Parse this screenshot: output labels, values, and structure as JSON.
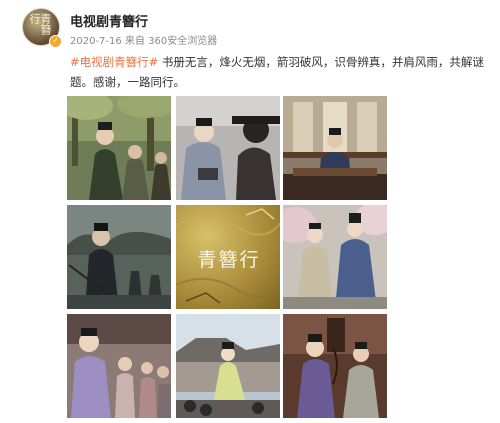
{
  "account": {
    "name": "电视剧青簪行",
    "avatar_text": "青簪行",
    "verified_icon": "verified-badge-icon"
  },
  "post": {
    "meta": "2020-7-16  来自 360安全浏览器",
    "hashtag": "#电视剧青簪行#",
    "text": " 书册无言，烽火无烟，箭羽破风，识骨辨真，并肩风雨，共解谜题。感谢，一路同行。"
  },
  "images": [
    {
      "name": "photo-1"
    },
    {
      "name": "photo-2"
    },
    {
      "name": "photo-3"
    },
    {
      "name": "photo-4"
    },
    {
      "name": "title-logo",
      "text": "青簪行"
    },
    {
      "name": "photo-6"
    },
    {
      "name": "photo-7"
    },
    {
      "name": "photo-8"
    },
    {
      "name": "photo-9"
    }
  ],
  "colors": {
    "hashtag": "#eb7340",
    "meta": "#8a8a8a"
  }
}
